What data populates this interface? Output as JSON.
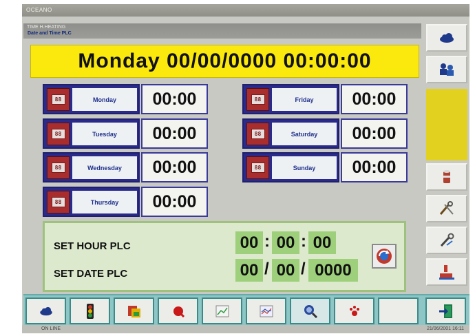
{
  "app_title": "OCEANO",
  "breadcrumb": {
    "section": "TIME H.HEATING",
    "page": "Date and Time PLC"
  },
  "current_datetime": "Monday 00/00/0000  00:00:00",
  "days": [
    {
      "label": "Monday",
      "time": "00:00"
    },
    {
      "label": "Tuesday",
      "time": "00:00"
    },
    {
      "label": "Wednesday",
      "time": "00:00"
    },
    {
      "label": "Thursday",
      "time": "00:00"
    },
    {
      "label": "Friday",
      "time": "00:00"
    },
    {
      "label": "Saturday",
      "time": "00:00"
    },
    {
      "label": "Sunday",
      "time": "00:00"
    }
  ],
  "calendar_glyph": "88",
  "set_panel": {
    "hour_label": "SET HOUR PLC",
    "date_label": "SET DATE PLC",
    "hour": {
      "hh": "00",
      "mm": "00",
      "ss": "00"
    },
    "date": {
      "dd": "00",
      "mo": "00",
      "yyyy": "0000"
    }
  },
  "time_separator": ":",
  "date_separator": "/",
  "side_icons": [
    "cloud-icon",
    "users-icon",
    "cylinder-icon",
    "tools-icon",
    "wrench-icon",
    "hand-icon"
  ],
  "toolbar_icons": [
    "cloud-icon",
    "traffic-light-icon",
    "folders-icon",
    "alarm-icon",
    "chart-icon",
    "trend-icon",
    "search-icon",
    "paw-icon",
    "empty",
    "exit-icon"
  ],
  "status": {
    "left": "ON LINE",
    "right": "21/06/2001  16:11"
  },
  "colors": {
    "banner": "#fbe90e",
    "day_border": "#2a2a8a",
    "set_panel": "#dce9cc",
    "digit_seg": "#9ed07c",
    "toolbar": "#8ec6c6"
  }
}
